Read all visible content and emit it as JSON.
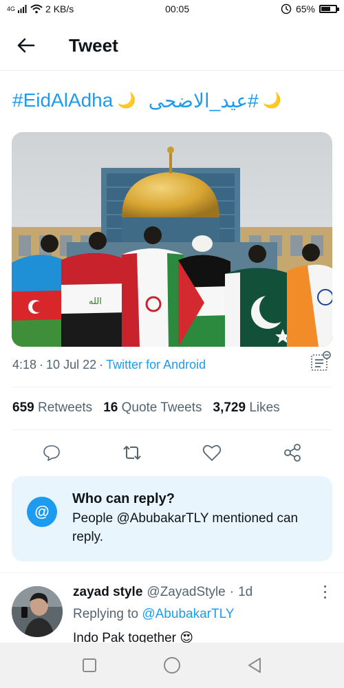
{
  "status_bar": {
    "network": "4G",
    "speed": "2 KB/s",
    "time": "00:05",
    "battery": "65%",
    "battery_level": 0.65
  },
  "header": {
    "title": "Tweet"
  },
  "tweet": {
    "hashtag_en": "#EidAlAdha",
    "hashtag_ar": "#عيد_الاضحى",
    "moon_emoji": "🌙",
    "time": "4:18",
    "date": "10 Jul 22",
    "separator": "·",
    "source": "Twitter for Android",
    "stats": {
      "retweets_count": "659",
      "retweets_label": "Retweets",
      "quotes_count": "16",
      "quotes_label": "Quote Tweets",
      "likes_count": "3,729",
      "likes_label": "Likes"
    }
  },
  "icons": {
    "back": "arrow-left-icon",
    "reply": "comment-icon",
    "retweet": "retweet-icon",
    "like": "heart-icon",
    "share": "share-icon",
    "analytics": "analytics-icon"
  },
  "who_can_reply": {
    "icon_text": "@",
    "title": "Who can reply?",
    "body": "People @AbubakarTLY mentioned can reply."
  },
  "reply_tweet": {
    "name": "zayad style",
    "handle": "@ZayadStyle",
    "separator": "·",
    "age": "1d",
    "replying_prefix": "Replying to",
    "replying_handle": "@AbubakarTLY",
    "text": "Indo Pak together 😍"
  },
  "colors": {
    "accent": "#1d9bf0",
    "secondary_text": "#536471",
    "reply_box_bg": "#e8f5fd",
    "dome_gold": "#d8a632"
  }
}
